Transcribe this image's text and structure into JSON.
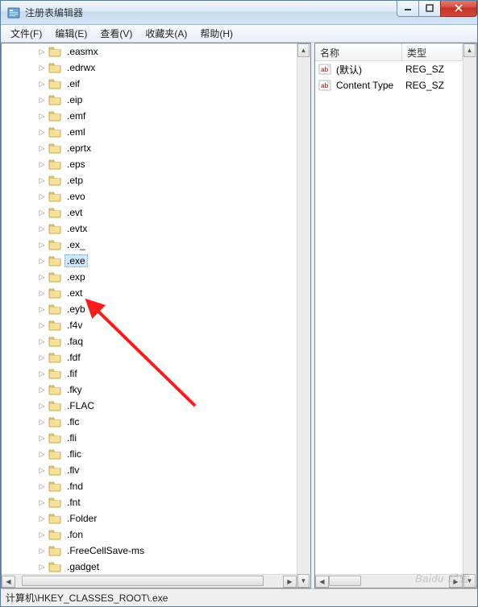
{
  "window": {
    "title": "注册表编辑器"
  },
  "menu": {
    "file": "文件(F)",
    "edit": "编辑(E)",
    "view": "查看(V)",
    "favorites": "收藏夹(A)",
    "help": "帮助(H)"
  },
  "tree": {
    "indent_base": 44,
    "selected_index": 12,
    "items": [
      {
        "label": ".easmx"
      },
      {
        "label": ".edrwx"
      },
      {
        "label": ".eif"
      },
      {
        "label": ".eip"
      },
      {
        "label": ".emf"
      },
      {
        "label": ".eml"
      },
      {
        "label": ".eprtx"
      },
      {
        "label": ".eps"
      },
      {
        "label": ".etp"
      },
      {
        "label": ".evo"
      },
      {
        "label": ".evt"
      },
      {
        "label": ".evtx"
      },
      {
        "label": ".ex_"
      },
      {
        "label": ".exe"
      },
      {
        "label": ".exp"
      },
      {
        "label": ".ext"
      },
      {
        "label": ".eyb"
      },
      {
        "label": ".f4v"
      },
      {
        "label": ".faq"
      },
      {
        "label": ".fdf"
      },
      {
        "label": ".fif"
      },
      {
        "label": ".fky"
      },
      {
        "label": ".FLAC"
      },
      {
        "label": ".flc"
      },
      {
        "label": ".fli"
      },
      {
        "label": ".flic"
      },
      {
        "label": ".flv"
      },
      {
        "label": ".fnd"
      },
      {
        "label": ".fnt"
      },
      {
        "label": ".Folder"
      },
      {
        "label": ".fon"
      },
      {
        "label": ".FreeCellSave-ms"
      },
      {
        "label": ".gadget"
      }
    ]
  },
  "list": {
    "columns": {
      "name": "名称",
      "type": "类型"
    },
    "rows": [
      {
        "name": "(默认)",
        "type": "REG_SZ"
      },
      {
        "name": "Content Type",
        "type": "REG_SZ"
      }
    ]
  },
  "statusbar": {
    "path": "计算机\\HKEY_CLASSES_ROOT\\.exe"
  },
  "watermark": "Baidu 经验",
  "icons": {
    "expander_collapsed": "▷",
    "scroll_left": "◀",
    "scroll_right": "▶",
    "scroll_up": "▲",
    "scroll_down": "▼"
  },
  "colors": {
    "arrow": "#ff1a1a"
  }
}
